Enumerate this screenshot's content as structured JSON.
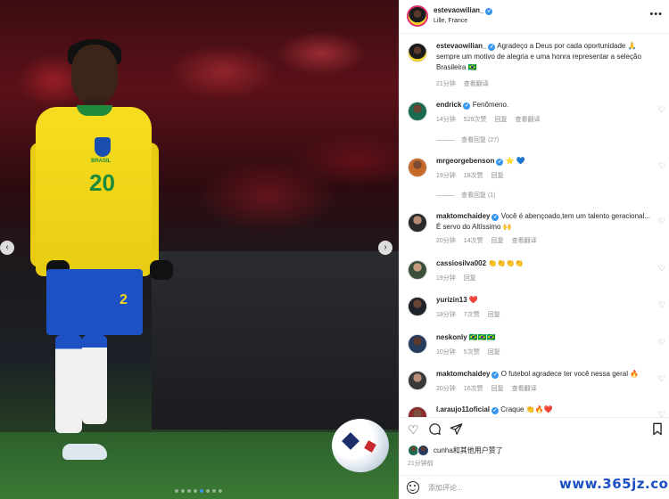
{
  "header": {
    "username": "estevaowilian_",
    "location": "Lille, France",
    "more_icon": "more-horizontal-icon"
  },
  "post": {
    "caption_user": "estevaowilian_",
    "caption_text": "Agradeço a Deus por cada oportunidade 🙏 sempre um motivo de alegria e uma honra representar a seleção Brasileira 🇧🇷",
    "time": "21分钟",
    "translate": "查看翻译"
  },
  "comments": [
    {
      "user": "endrick",
      "text": "Fenômeno.",
      "time": "14分钟",
      "likes": "529次赞",
      "reply": "回复",
      "translate": "查看翻译",
      "view_replies": "查看回复 (27)"
    },
    {
      "user": "mrgeorgebenson",
      "text": "⭐ 💙",
      "time": "19分钟",
      "likes": "18次赞",
      "reply": "回复",
      "view_replies": "查看回复 (1)"
    },
    {
      "user": "maktomchaidey",
      "text": "Você é abençoado,tem um talento geracional... É servo do Altíssimo 🙌",
      "time": "20分钟",
      "likes": "14次赞",
      "reply": "回复",
      "translate": "查看翻译"
    },
    {
      "user": "cassiosilva002",
      "text": "👏👏👏👏",
      "time": "19分钟",
      "reply": "回复"
    },
    {
      "user": "yurizin13",
      "text": "❤️",
      "time": "18分钟",
      "likes": "7次赞",
      "reply": "回复"
    },
    {
      "user": "neskonly",
      "text": "🇧🇷🇧🇷🇧🇷",
      "time": "10分钟",
      "likes": "5次赞",
      "reply": "回复"
    },
    {
      "user": "maktomchaidey",
      "text": "O futebol agradece ter você nessa geral 🔥",
      "time": "20分钟",
      "likes": "16次赞",
      "reply": "回复",
      "translate": "查看翻译"
    },
    {
      "user": "l.araujo11oficial",
      "text": "Craque 👏🔥❤️",
      "time": ""
    }
  ],
  "photo": {
    "shirt_number": "20",
    "shirt_brand": "BRASIL",
    "short_number": "2",
    "prev_icon": "chevron-left-icon",
    "next_icon": "chevron-right-icon",
    "slide_count": 8,
    "active_slide": 4
  },
  "actions": {
    "like_icon": "heart-icon",
    "comment_icon": "comment-bubble-icon",
    "share_icon": "paper-plane-icon",
    "save_icon": "bookmark-icon"
  },
  "likes": {
    "text": "cunha和其他用户赞了",
    "time": "21分钟前"
  },
  "composer": {
    "placeholder": "添加评论...",
    "emoji_icon": "smiley-icon"
  },
  "watermark": "www.365jz.com",
  "colors": {
    "verified": "#3897f0",
    "text": "#262626",
    "muted": "#8e8e8e",
    "watermark": "#1b4fc4"
  }
}
